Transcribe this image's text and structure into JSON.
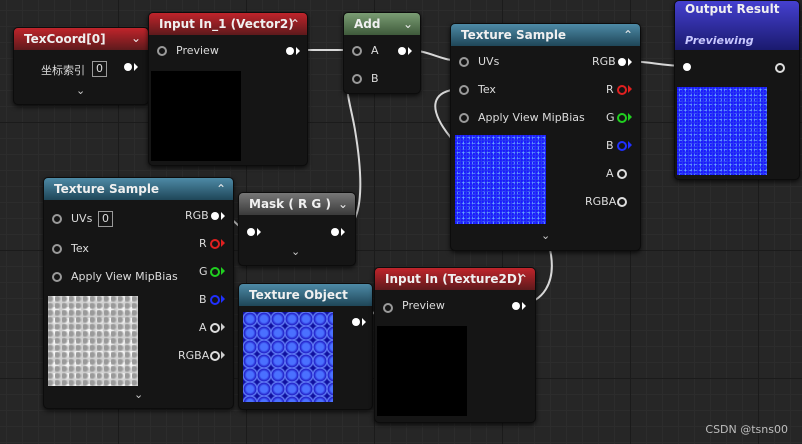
{
  "nodes": {
    "texcoord": {
      "title": "TexCoord[0]",
      "index_label": "坐标索引",
      "index_value": "0"
    },
    "input_vec2": {
      "title": "Input In_1 (Vector2)",
      "preview_label": "Preview"
    },
    "add": {
      "title": "Add",
      "pin_a": "A",
      "pin_b": "B"
    },
    "texsample_top": {
      "title": "Texture Sample",
      "uvs": "UVs",
      "tex": "Tex",
      "mip": "Apply View MipBias",
      "rgb": "RGB",
      "r": "R",
      "g": "G",
      "b": "B",
      "a": "A",
      "rgba": "RGBA"
    },
    "output": {
      "title": "Output Result",
      "subtitle": "Previewing"
    },
    "texsample_left": {
      "title": "Texture Sample",
      "uvs": "UVs",
      "uvs_value": "0",
      "tex": "Tex",
      "mip": "Apply View MipBias",
      "rgb": "RGB",
      "r": "R",
      "g": "G",
      "b": "B",
      "a": "A",
      "rgba": "RGBA"
    },
    "mask": {
      "title": "Mask ( R G )"
    },
    "texobject": {
      "title": "Texture Object"
    },
    "input_tex2d": {
      "title": "Input In (Texture2D)",
      "preview_label": "Preview"
    }
  },
  "icons": {
    "expand": "chevron-down-icon",
    "collapse": "chevron-up-icon"
  },
  "colors": {
    "header_red": "#c0242b",
    "header_green": "#7a9c73",
    "header_blue": "#4d8aa6",
    "header_purple": "#4540d0",
    "pin_red": "#e02020",
    "pin_green": "#20d020",
    "pin_blue": "#2030ff"
  },
  "watermark": "CSDN @tsns00"
}
